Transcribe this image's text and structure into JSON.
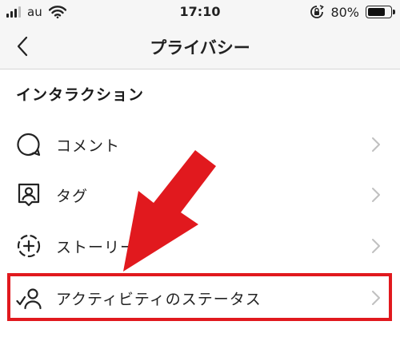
{
  "status_bar": {
    "carrier": "au",
    "time": "17:10",
    "battery": "80%",
    "battery_level": 0.8
  },
  "nav": {
    "title": "プライバシー"
  },
  "section": {
    "title": "インタラクション"
  },
  "rows": [
    {
      "label": "コメント",
      "icon": "comment-icon"
    },
    {
      "label": "タグ",
      "icon": "tag-person-icon"
    },
    {
      "label": "ストーリーズ",
      "icon": "story-add-icon"
    },
    {
      "label": "アクティビティのステータス",
      "icon": "activity-status-icon"
    }
  ],
  "annotation": {
    "arrow_color": "#e1191e",
    "box_color": "#e1191e",
    "highlighted_row": "アクティビティのステータス"
  }
}
